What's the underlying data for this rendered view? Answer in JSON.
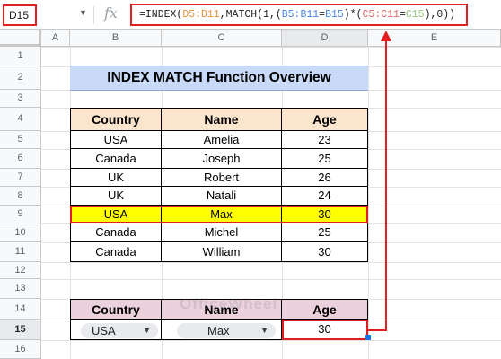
{
  "formula_bar": {
    "name_box": "D15",
    "fx_symbol": "fx",
    "formula": [
      {
        "text": "=INDEX(",
        "cls": ""
      },
      {
        "text": "D5:D11",
        "cls": "r1"
      },
      {
        "text": ",MATCH(1,(",
        "cls": ""
      },
      {
        "text": "B5:B11",
        "cls": "r2"
      },
      {
        "text": "=",
        "cls": ""
      },
      {
        "text": "B15",
        "cls": "r2"
      },
      {
        "text": ")*(",
        "cls": ""
      },
      {
        "text": "C5:C11",
        "cls": "r3"
      },
      {
        "text": "=",
        "cls": ""
      },
      {
        "text": "C15",
        "cls": "r4"
      },
      {
        "text": "),0))",
        "cls": ""
      }
    ]
  },
  "columns": [
    "A",
    "B",
    "C",
    "D",
    "E"
  ],
  "rows": [
    "1",
    "2",
    "3",
    "4",
    "5",
    "6",
    "7",
    "8",
    "9",
    "10",
    "11",
    "12",
    "13",
    "14",
    "15",
    "16"
  ],
  "selected_cell": {
    "column": "D",
    "row": "15"
  },
  "title": "INDEX MATCH Function Overview",
  "table": {
    "headers": [
      "Country",
      "Name",
      "Age"
    ],
    "rows": [
      [
        "USA",
        "Amelia",
        "23"
      ],
      [
        "Canada",
        "Joseph",
        "25"
      ],
      [
        "UK",
        "Robert",
        "26"
      ],
      [
        "UK",
        "Natali",
        "24"
      ],
      [
        "USA",
        "Max",
        "30"
      ],
      [
        "Canada",
        "Michel",
        "25"
      ],
      [
        "Canada",
        "William",
        "30"
      ]
    ],
    "highlight_row_index": 4
  },
  "lookup": {
    "headers": [
      "Country",
      "Name",
      "Age"
    ],
    "country_chip": "USA",
    "name_chip": "Max",
    "result": "30"
  },
  "watermark": "OfficeWheel",
  "colors": {
    "title_bg": "#c9daf8",
    "header_bg": "#fce5cd",
    "lookup_header_bg": "#ead1dc",
    "highlight_bg": "#ffff00",
    "annotation_red": "#e02020"
  }
}
